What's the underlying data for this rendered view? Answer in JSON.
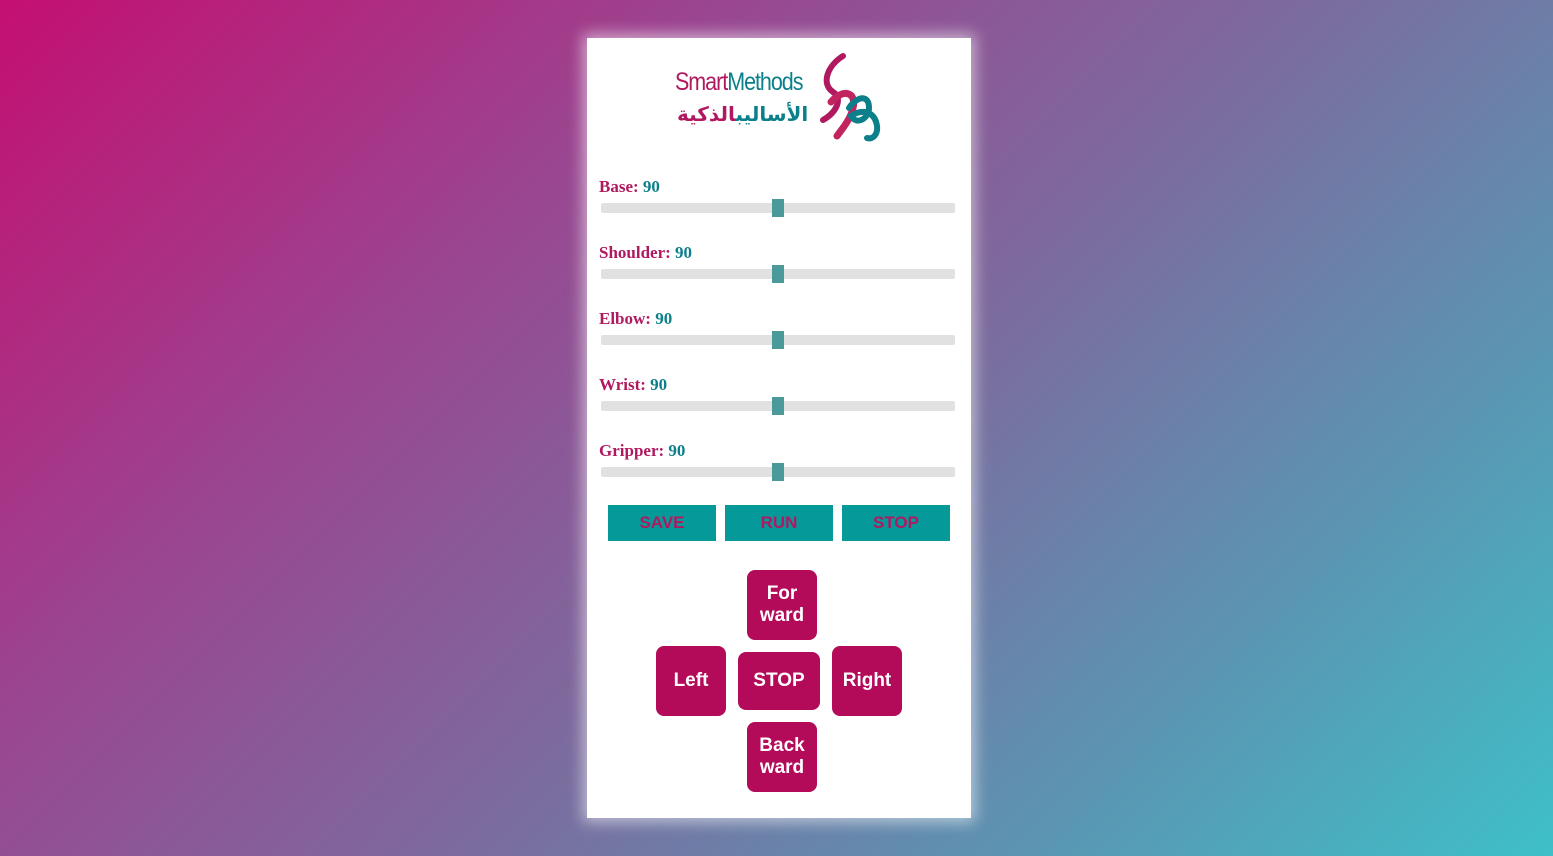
{
  "logo": {
    "english_part1": "Smart",
    "english_part2": "Methods",
    "arabic_part1": "الأساليب",
    "arabic_part2": "الذكية"
  },
  "sliders": [
    {
      "label": "Base:",
      "value": 90,
      "max": 180
    },
    {
      "label": "Shoulder:",
      "value": 90,
      "max": 180
    },
    {
      "label": "Elbow:",
      "value": 90,
      "max": 180
    },
    {
      "label": "Wrist:",
      "value": 90,
      "max": 180
    },
    {
      "label": "Gripper:",
      "value": 90,
      "max": 180
    }
  ],
  "actions": {
    "save": "SAVE",
    "run": "RUN",
    "stop": "STOP"
  },
  "directions": {
    "forward_line1": "For",
    "forward_line2": "ward",
    "left": "Left",
    "stop": "STOP",
    "right": "Right",
    "backward_line1": "Back",
    "backward_line2": "ward"
  },
  "colors": {
    "label": "#b0195f",
    "value": "#0b7f8a",
    "action_bg": "#05999a",
    "action_text": "#b0195f",
    "direction_bg": "#b40a5a",
    "thumb": "#4a9a9a",
    "track": "#e1e1e1"
  }
}
